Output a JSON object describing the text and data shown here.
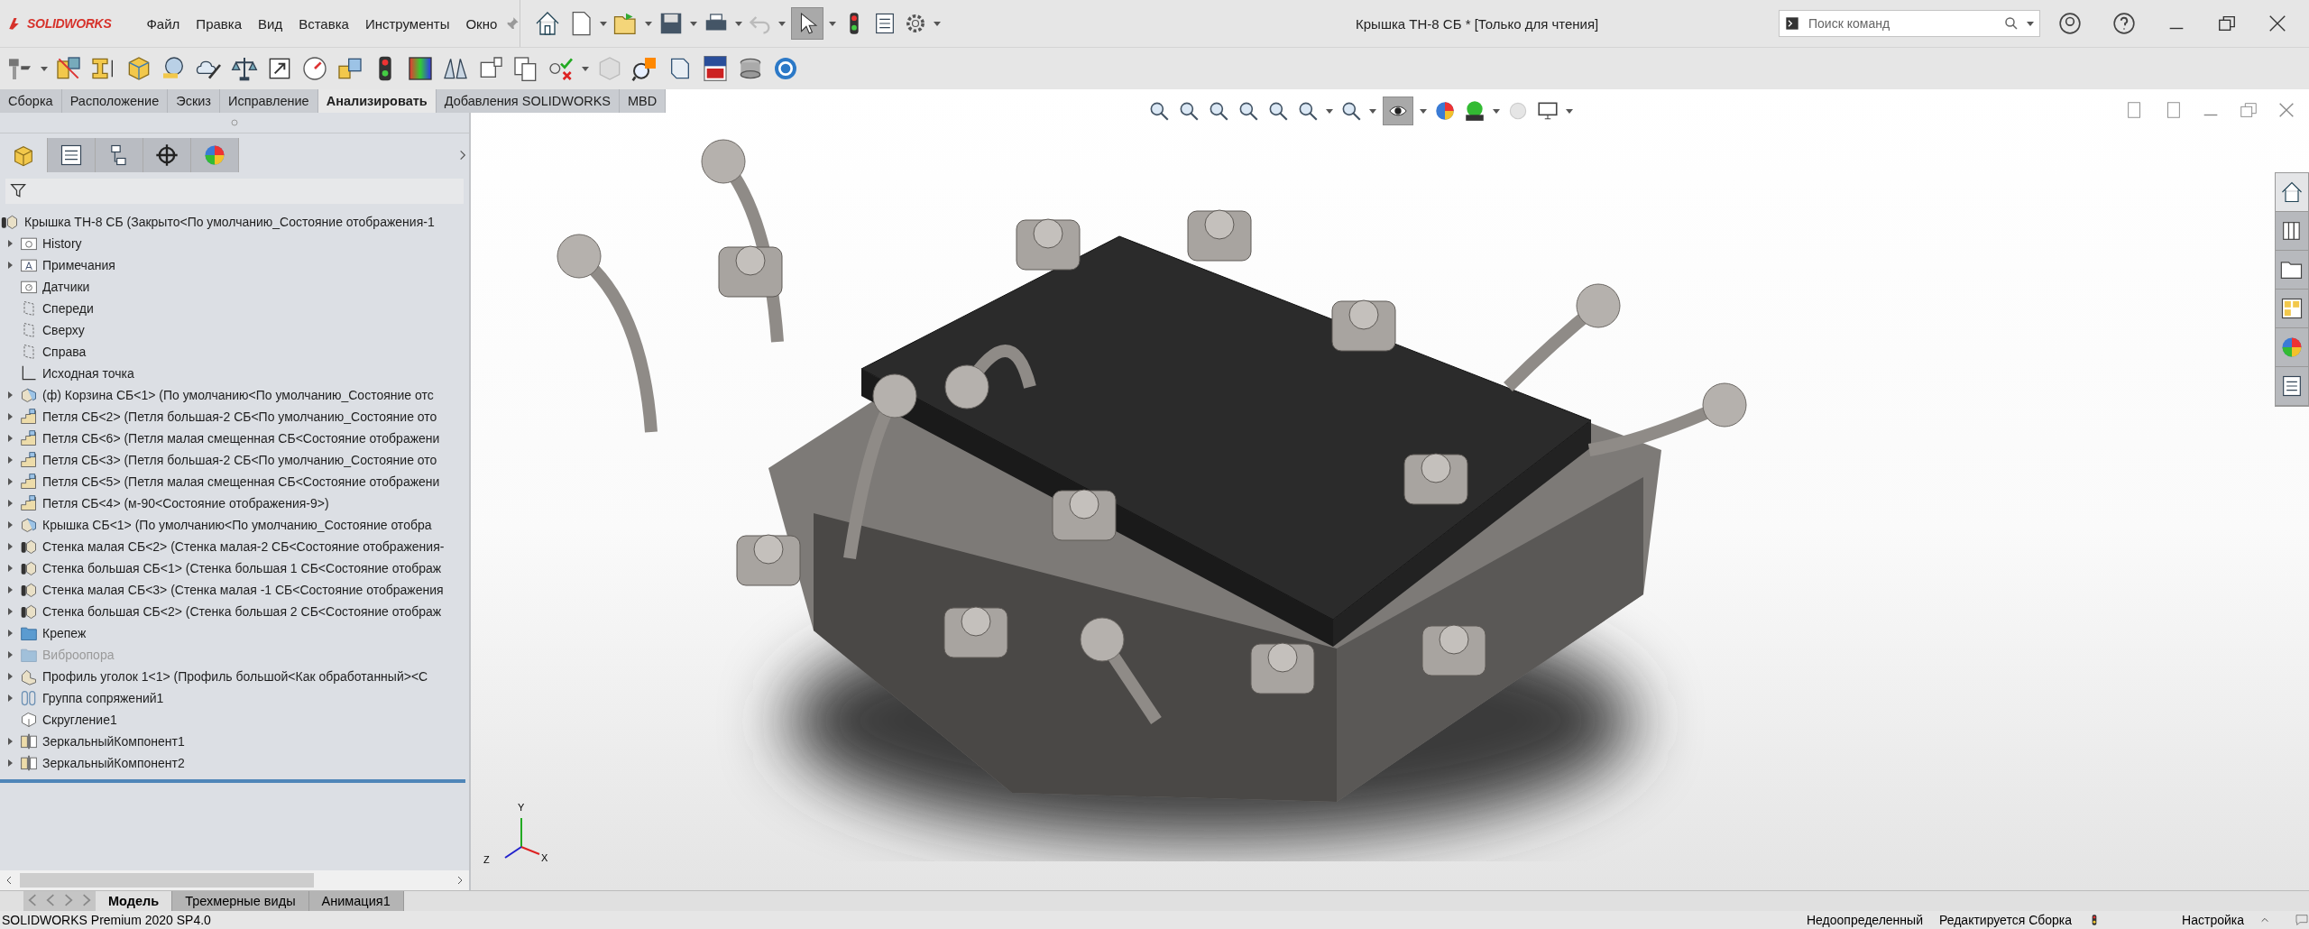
{
  "app": {
    "logo": "SOLIDWORKS",
    "menu": [
      "Файл",
      "Правка",
      "Вид",
      "Вставка",
      "Инструменты",
      "Окно"
    ],
    "title": "Крышка ТН-8 СБ * [Только для чтения]",
    "search": {
      "placeholder": "Поиск команд"
    }
  },
  "command_tabs": [
    {
      "label": "Сборка",
      "selected": false
    },
    {
      "label": "Расположение",
      "selected": false
    },
    {
      "label": "Эскиз",
      "selected": false
    },
    {
      "label": "Исправление",
      "selected": false
    },
    {
      "label": "Анализировать",
      "selected": true
    },
    {
      "label": "Добавления SOLIDWORKS",
      "selected": false
    },
    {
      "label": "MBD",
      "selected": false
    }
  ],
  "panel_tabs": [
    {
      "kind": "feature",
      "selected": true
    },
    {
      "kind": "property",
      "selected": false
    },
    {
      "kind": "configuration",
      "selected": false
    },
    {
      "kind": "dimxpert",
      "selected": false
    },
    {
      "kind": "display",
      "selected": false
    }
  ],
  "tree": {
    "root": {
      "label": "Крышка ТН-8 СБ  (Закрыто<По умолчанию_Состояние отображения-1",
      "children": [
        {
          "label": "History",
          "kind": "history",
          "expandable": true,
          "suppressed": false
        },
        {
          "label": "Примечания",
          "kind": "notes",
          "expandable": true,
          "suppressed": false
        },
        {
          "label": "Датчики",
          "kind": "sensors",
          "expandable": false,
          "suppressed": false
        },
        {
          "label": "Спереди",
          "kind": "plane",
          "expandable": false,
          "suppressed": false
        },
        {
          "label": "Сверху",
          "kind": "plane",
          "expandable": false,
          "suppressed": false
        },
        {
          "label": "Справа",
          "kind": "plane",
          "expandable": false,
          "suppressed": false
        },
        {
          "label": "Исходная точка",
          "kind": "origin",
          "expandable": false,
          "suppressed": false
        },
        {
          "label": "(ф) Корзина СБ<1> (По умолчанию<По умолчанию_Состояние отс",
          "kind": "assembly",
          "expandable": true,
          "suppressed": false
        },
        {
          "label": "Петля СБ<2> (Петля большая-2 СБ<По умолчанию_Состояние ото",
          "kind": "flexible",
          "expandable": true,
          "suppressed": false
        },
        {
          "label": "Петля СБ<6> (Петля малая смещенная СБ<Состояние отображени",
          "kind": "flexible",
          "expandable": true,
          "suppressed": false
        },
        {
          "label": "Петля СБ<3> (Петля большая-2 СБ<По умолчанию_Состояние ото",
          "kind": "flexible",
          "expandable": true,
          "suppressed": false
        },
        {
          "label": "Петля СБ<5> (Петля малая смещенная СБ<Состояние отображени",
          "kind": "flexible",
          "expandable": true,
          "suppressed": false
        },
        {
          "label": "Петля СБ<4> (м-90<Состояние отображения-9>)",
          "kind": "flexible",
          "expandable": true,
          "suppressed": false
        },
        {
          "label": "Крышка СБ<1> (По умолчанию<По умолчанию_Состояние отобра",
          "kind": "assembly",
          "expandable": true,
          "suppressed": false
        },
        {
          "label": "Стенка малая СБ<2> (Стенка малая-2 СБ<Состояние отображения-",
          "kind": "rebuild",
          "expandable": true,
          "suppressed": false
        },
        {
          "label": "Стенка большая СБ<1> (Стенка большая 1 СБ<Состояние отображ",
          "kind": "rebuild",
          "expandable": true,
          "suppressed": false
        },
        {
          "label": "Стенка малая СБ<3> (Стенка малая -1 СБ<Состояние отображения",
          "kind": "rebuild",
          "expandable": true,
          "suppressed": false
        },
        {
          "label": "Стенка большая СБ<2> (Стенка большая 2 СБ<Состояние отображ",
          "kind": "rebuild",
          "expandable": true,
          "suppressed": false
        },
        {
          "label": "Крепеж",
          "kind": "folder",
          "expandable": true,
          "suppressed": false
        },
        {
          "label": "Виброопора",
          "kind": "folder",
          "expandable": true,
          "suppressed": true
        },
        {
          "label": "Профиль уголок 1<1> (Профиль большой<Как обработанный><С",
          "kind": "part",
          "expandable": true,
          "suppressed": false
        },
        {
          "label": "Группа сопряжений1",
          "kind": "mates",
          "expandable": true,
          "suppressed": false
        },
        {
          "label": "Скругление1",
          "kind": "fillet",
          "expandable": false,
          "suppressed": false
        },
        {
          "label": "ЗеркальныйКомпонент1",
          "kind": "mirror",
          "expandable": true,
          "suppressed": false
        },
        {
          "label": "ЗеркальныйКомпонент2",
          "kind": "mirror",
          "expandable": true,
          "suppressed": false
        }
      ]
    }
  },
  "task_pane": [
    {
      "kind": "home",
      "selected": true
    },
    {
      "kind": "library",
      "selected": false
    },
    {
      "kind": "files",
      "selected": false
    },
    {
      "kind": "palette",
      "selected": false
    },
    {
      "kind": "appearance",
      "selected": false
    },
    {
      "kind": "properties",
      "selected": false
    }
  ],
  "triad": {
    "y": "Y",
    "z": "Z",
    "x": "X"
  },
  "bottom_tabs": [
    {
      "label": "Модель",
      "selected": true
    },
    {
      "label": "Трехмерные виды",
      "selected": false
    },
    {
      "label": "Анимация1",
      "selected": false
    }
  ],
  "status_bar": {
    "version": "SOLIDWORKS Premium 2020 SP4.0",
    "state": "Недоопределенный",
    "mode": "Редактируется Сборка",
    "settings": "Настройка"
  }
}
